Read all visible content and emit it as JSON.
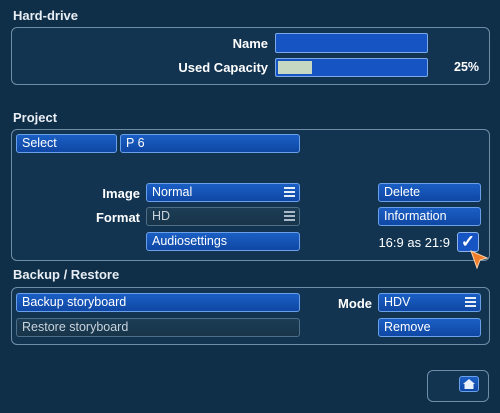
{
  "harddrive": {
    "title": "Hard-drive",
    "name_label": "Name",
    "name_value": "",
    "used_label": "Used Capacity",
    "used_fraction": 0.25,
    "used_percent_text": "25%"
  },
  "project": {
    "title": "Project",
    "select_label": "Select",
    "project_name": "P 6",
    "image_label": "Image",
    "image_value": "Normal",
    "format_label": "Format",
    "format_value": "HD",
    "audio_label": "Audiosettings",
    "delete_label": "Delete",
    "info_label": "Information",
    "aspect_label": "16:9 as 21:9",
    "aspect_checked": true
  },
  "backup": {
    "title": "Backup / Restore",
    "backup_label": "Backup storyboard",
    "restore_label": "Restore storyboard",
    "mode_label": "Mode",
    "mode_value": "HDV",
    "remove_label": "Remove"
  },
  "icons": {
    "menu": "menu-lines-icon",
    "check": "checkmark-icon",
    "home": "home-icon",
    "cursor": "pointer-cursor-icon"
  },
  "colors": {
    "background": "#0f2e47",
    "button": "#1654c4",
    "progress": "#c7d8c2",
    "cursor": "#f07d2a"
  }
}
